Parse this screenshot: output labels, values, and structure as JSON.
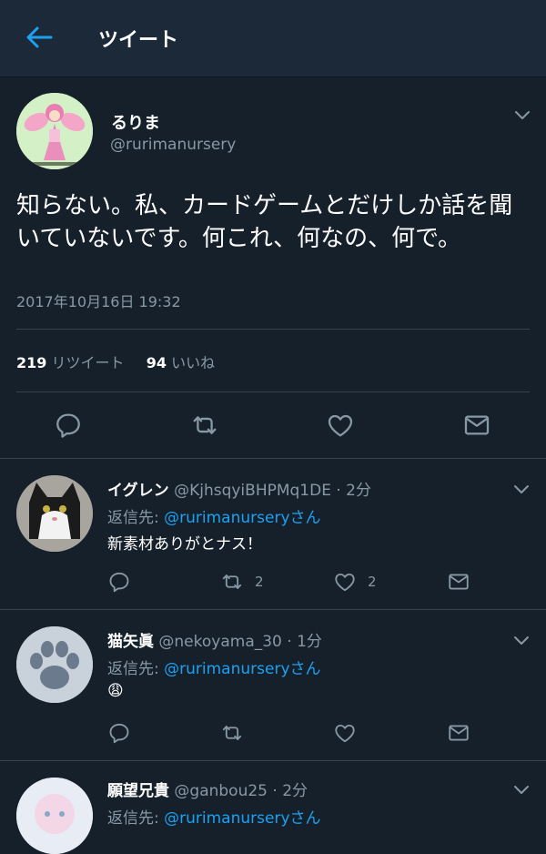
{
  "header": {
    "title": "ツイート"
  },
  "tweet": {
    "name": "るりま",
    "handle": "@rurimanursery",
    "text": "知らない。私、カードゲームとだけしか話を聞いていないです。何これ、何なの、何で。",
    "timestamp": "2017年10月16日 19:32",
    "retweets": "219",
    "retweets_label": "リツイート",
    "likes": "94",
    "likes_label": "いいね"
  },
  "replies": [
    {
      "name": "イグレン",
      "handle": "@KjhsqyiBHPMq1DE",
      "time": "· 2分",
      "reply_prefix": "返信先: ",
      "reply_to": "@rurimanurseryさん",
      "text": "新素材ありがとナス！",
      "retweet_count": "2",
      "like_count": "2"
    },
    {
      "name": "猫矢眞",
      "handle": "@nekoyama_30",
      "time": "· 1分",
      "reply_prefix": "返信先: ",
      "reply_to": "@rurimanurseryさん",
      "text": "😩",
      "retweet_count": "",
      "like_count": ""
    },
    {
      "name": "願望兄貴",
      "handle": "@ganbou25",
      "time": "· 2分",
      "reply_prefix": "返信先: ",
      "reply_to": "@rurimanurseryさん"
    }
  ],
  "colors": {
    "background": "#15202b",
    "header": "#1c2938",
    "accent": "#1da1f2",
    "secondary_text": "#8899a6",
    "divider": "#38444d"
  },
  "icons": [
    "back-arrow-icon",
    "chevron-down-icon",
    "reply-icon",
    "retweet-icon",
    "like-icon",
    "direct-message-icon"
  ]
}
